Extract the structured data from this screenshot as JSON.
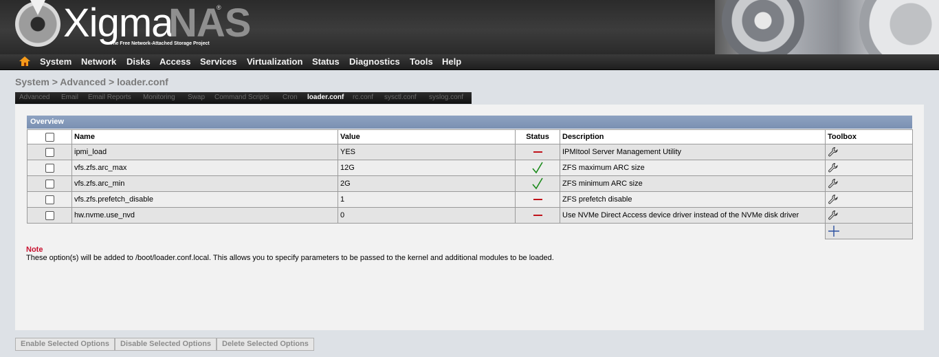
{
  "logo": {
    "brand_left": "Xigma",
    "brand_right": "NAS",
    "registered": "®",
    "tagline": "The Free Network-Attached Storage Project"
  },
  "nav": {
    "home_icon": "home-icon",
    "items": [
      "System",
      "Network",
      "Disks",
      "Access",
      "Services",
      "Virtualization",
      "Status",
      "Diagnostics",
      "Tools",
      "Help"
    ]
  },
  "breadcrumb": "System > Advanced > loader.conf",
  "tabs": {
    "items": [
      "Advanced",
      "Email",
      "Email Reports",
      "Monitoring",
      "Swap",
      "Command Scripts",
      "Cron",
      "loader.conf",
      "rc.conf",
      "sysctl.conf",
      "syslog.conf"
    ],
    "active": "loader.conf"
  },
  "overview": {
    "title": "Overview",
    "columns": {
      "name": "Name",
      "value": "Value",
      "status": "Status",
      "description": "Description",
      "toolbox": "Toolbox"
    },
    "rows": [
      {
        "name": "ipmi_load",
        "value": "YES",
        "status": "disabled",
        "description": "IPMItool Server Management Utility"
      },
      {
        "name": "vfs.zfs.arc_max",
        "value": "12G",
        "status": "enabled",
        "description": "ZFS maximum ARC size"
      },
      {
        "name": "vfs.zfs.arc_min",
        "value": "2G",
        "status": "enabled",
        "description": "ZFS minimum ARC size"
      },
      {
        "name": "vfs.zfs.prefetch_disable",
        "value": "1",
        "status": "disabled",
        "description": "ZFS prefetch disable"
      },
      {
        "name": "hw.nvme.use_nvd",
        "value": "0",
        "status": "disabled",
        "description": "Use NVMe Direct Access device driver instead of the NVMe disk driver"
      }
    ],
    "status_icons": {
      "enabled": "check-icon",
      "disabled": "dash-icon"
    },
    "row_tool_icon": "wrench-icon",
    "add_icon": "plus-icon"
  },
  "note": {
    "label": "Note",
    "text": "These option(s) will be added to /boot/loader.conf.local. This allows you to specify parameters to be passed to the kernel and additional modules to be loaded."
  },
  "buttons": {
    "enable": "Enable Selected Options",
    "disable": "Disable Selected Options",
    "delete": "Delete Selected Options"
  },
  "colors": {
    "accent_red": "#c0121a",
    "check_green": "#1a8a1a",
    "header_blue": "#7a90b2",
    "icon_blue": "#2a4fa0"
  }
}
